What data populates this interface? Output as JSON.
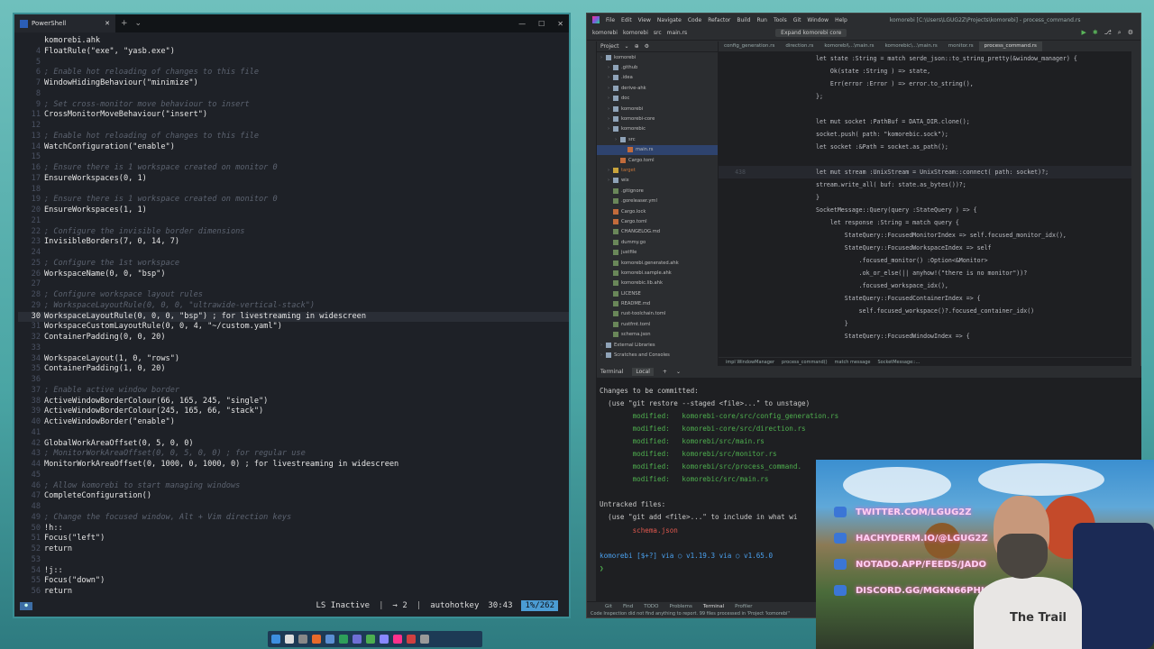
{
  "terminal": {
    "tab_title": "PowerShell",
    "filename": "komorebi.ahk",
    "lines": [
      {
        "n": "",
        "t": "komorebi.ahk",
        "c": false
      },
      {
        "n": "4",
        "t": "FloatRule(\"exe\", \"yasb.exe\")",
        "c": false
      },
      {
        "n": "5",
        "t": "",
        "c": false
      },
      {
        "n": "6",
        "t": "; Enable hot reloading of changes to this file",
        "c": true
      },
      {
        "n": "7",
        "t": "WindowHidingBehaviour(\"minimize\")",
        "c": false
      },
      {
        "n": "8",
        "t": "",
        "c": false
      },
      {
        "n": "9",
        "t": "; Set cross-monitor move behaviour to insert",
        "c": true
      },
      {
        "n": "11",
        "t": "CrossMonitorMoveBehaviour(\"insert\")",
        "c": false
      },
      {
        "n": "12",
        "t": "",
        "c": false
      },
      {
        "n": "13",
        "t": "; Enable hot reloading of changes to this file",
        "c": true
      },
      {
        "n": "14",
        "t": "WatchConfiguration(\"enable\")",
        "c": false
      },
      {
        "n": "15",
        "t": "",
        "c": false
      },
      {
        "n": "16",
        "t": "; Ensure there is 1 workspace created on monitor 0",
        "c": true
      },
      {
        "n": "17",
        "t": "EnsureWorkspaces(0, 1)",
        "c": false
      },
      {
        "n": "18",
        "t": "",
        "c": false
      },
      {
        "n": "19",
        "t": "; Ensure there is 1 workspace created on monitor 0",
        "c": true
      },
      {
        "n": "20",
        "t": "EnsureWorkspaces(1, 1)",
        "c": false
      },
      {
        "n": "21",
        "t": "",
        "c": false
      },
      {
        "n": "22",
        "t": "; Configure the invisible border dimensions",
        "c": true
      },
      {
        "n": "23",
        "t": "InvisibleBorders(7, 0, 14, 7)",
        "c": false
      },
      {
        "n": "24",
        "t": "",
        "c": false
      },
      {
        "n": "25",
        "t": "; Configure the 1st workspace",
        "c": true
      },
      {
        "n": "26",
        "t": "WorkspaceName(0, 0, \"bsp\")",
        "c": false
      },
      {
        "n": "27",
        "t": "",
        "c": false
      },
      {
        "n": "28",
        "t": "; Configure workspace layout rules",
        "c": true
      },
      {
        "n": "29",
        "t": "; WorkspaceLayoutRule(0, 0, 0, \"ultrawide-vertical-stack\")",
        "c": true
      },
      {
        "n": "30",
        "t": "WorkspaceLayoutRule(0, 0, 0, \"bsp\") ; for livestreaming in widescreen",
        "c": false,
        "cur": true
      },
      {
        "n": "31",
        "t": "WorkspaceCustomLayoutRule(0, 0, 4, \"~/custom.yaml\")",
        "c": false
      },
      {
        "n": "32",
        "t": "ContainerPadding(0, 0, 20)",
        "c": false
      },
      {
        "n": "33",
        "t": "",
        "c": false
      },
      {
        "n": "34",
        "t": "WorkspaceLayout(1, 0, \"rows\")",
        "c": false
      },
      {
        "n": "35",
        "t": "ContainerPadding(1, 0, 20)",
        "c": false
      },
      {
        "n": "36",
        "t": "",
        "c": false
      },
      {
        "n": "37",
        "t": "; Enable active window border",
        "c": true
      },
      {
        "n": "38",
        "t": "ActiveWindowBorderColour(66, 165, 245, \"single\")",
        "c": false
      },
      {
        "n": "39",
        "t": "ActiveWindowBorderColour(245, 165, 66, \"stack\")",
        "c": false
      },
      {
        "n": "40",
        "t": "ActiveWindowBorder(\"enable\")",
        "c": false
      },
      {
        "n": "41",
        "t": "",
        "c": false
      },
      {
        "n": "42",
        "t": "GlobalWorkAreaOffset(0, 5, 0, 0)",
        "c": false
      },
      {
        "n": "43",
        "t": "; MonitorWorkAreaOffset(0, 0, 5, 0, 0) ; for regular use",
        "c": true
      },
      {
        "n": "44",
        "t": "MonitorWorkAreaOffset(0, 1000, 0, 1000, 0) ; for livestreaming in widescreen",
        "c": false
      },
      {
        "n": "45",
        "t": "",
        "c": false
      },
      {
        "n": "46",
        "t": "; Allow komorebi to start managing windows",
        "c": true
      },
      {
        "n": "47",
        "t": "CompleteConfiguration()",
        "c": false
      },
      {
        "n": "48",
        "t": "",
        "c": false
      },
      {
        "n": "49",
        "t": "; Change the focused window, Alt + Vim direction keys",
        "c": true
      },
      {
        "n": "50",
        "t": "!h::",
        "c": false
      },
      {
        "n": "51",
        "t": "Focus(\"left\")",
        "c": false
      },
      {
        "n": "52",
        "t": "return",
        "c": false
      },
      {
        "n": "53",
        "t": "",
        "c": false
      },
      {
        "n": "54",
        "t": "!j::",
        "c": false
      },
      {
        "n": "55",
        "t": "Focus(\"down\")",
        "c": false
      },
      {
        "n": "56",
        "t": "return",
        "c": false
      }
    ],
    "status": {
      "lsp": "LS Inactive",
      "windows": "→ 2",
      "filetype": "autohotkey",
      "position": "30:43",
      "percent": "1%/262"
    }
  },
  "ide": {
    "menu": [
      "File",
      "Edit",
      "View",
      "Navigate",
      "Code",
      "Refactor",
      "Build",
      "Run",
      "Tools",
      "Git",
      "Window",
      "Help"
    ],
    "window_title": "komorebi [C:\\Users\\LGUG2Z\\Projects\\komorebi] - process_command.rs",
    "breadcrumb_path": [
      "komorebi",
      "komorebi",
      "src",
      "main.rs"
    ],
    "toolbar_dropdown": "Expand komorebi core",
    "project_label": "Project",
    "tree": [
      {
        "label": "komorebi",
        "depth": 0,
        "kind": "fold"
      },
      {
        "label": ".github",
        "depth": 1,
        "kind": "fold"
      },
      {
        "label": ".idea",
        "depth": 1,
        "kind": "fold"
      },
      {
        "label": "derive-ahk",
        "depth": 1,
        "kind": "fold"
      },
      {
        "label": "doc",
        "depth": 1,
        "kind": "fold"
      },
      {
        "label": "komorebi",
        "depth": 1,
        "kind": "fold"
      },
      {
        "label": "komorebi-core",
        "depth": 1,
        "kind": "fold"
      },
      {
        "label": "komorebic",
        "depth": 1,
        "kind": "fold"
      },
      {
        "label": "src",
        "depth": 2,
        "kind": "fold"
      },
      {
        "label": "main.rs",
        "depth": 3,
        "kind": "file-r",
        "sel": true
      },
      {
        "label": "Cargo.toml",
        "depth": 2,
        "kind": "file-r"
      },
      {
        "label": "target",
        "depth": 1,
        "kind": "fold-y"
      },
      {
        "label": "wix",
        "depth": 1,
        "kind": "fold"
      },
      {
        "label": ".gitignore",
        "depth": 1,
        "kind": "file-g"
      },
      {
        "label": ".goreleaser.yml",
        "depth": 1,
        "kind": "file-g"
      },
      {
        "label": "Cargo.lock",
        "depth": 1,
        "kind": "file-r"
      },
      {
        "label": "Cargo.toml",
        "depth": 1,
        "kind": "file-r"
      },
      {
        "label": "CHANGELOG.md",
        "depth": 1,
        "kind": "file-g"
      },
      {
        "label": "dummy.go",
        "depth": 1,
        "kind": "file-g"
      },
      {
        "label": "justfile",
        "depth": 1,
        "kind": "file-g"
      },
      {
        "label": "komorebi.generated.ahk",
        "depth": 1,
        "kind": "file-g"
      },
      {
        "label": "komorebi.sample.ahk",
        "depth": 1,
        "kind": "file-g"
      },
      {
        "label": "komorebic.lib.ahk",
        "depth": 1,
        "kind": "file-g"
      },
      {
        "label": "LICENSE",
        "depth": 1,
        "kind": "file-g"
      },
      {
        "label": "README.md",
        "depth": 1,
        "kind": "file-g"
      },
      {
        "label": "rust-toolchain.toml",
        "depth": 1,
        "kind": "file-g"
      },
      {
        "label": "rustfmt.toml",
        "depth": 1,
        "kind": "file-g"
      },
      {
        "label": "schema.json",
        "depth": 1,
        "kind": "file-g"
      },
      {
        "label": "External Libraries",
        "depth": 0,
        "kind": "fold"
      },
      {
        "label": "Scratches and Consoles",
        "depth": 0,
        "kind": "fold"
      }
    ],
    "code_tabs": [
      "config_generation.rs",
      "direction.rs",
      "komorebi\\...\\main.rs",
      "komorebic\\...\\main.rs",
      "monitor.rs",
      "process_command.rs"
    ],
    "code_lines": [
      {
        "n": "",
        "t": "let state :String = match serde_json::to_string_pretty(&window_manager) {"
      },
      {
        "n": "",
        "t": "    Ok(state :String ) => state,"
      },
      {
        "n": "",
        "t": "    Err(error :Error ) => error.to_string(),"
      },
      {
        "n": "",
        "t": "};"
      },
      {
        "n": "",
        "t": ""
      },
      {
        "n": "",
        "t": "let mut socket :PathBuf = DATA_DIR.clone();"
      },
      {
        "n": "",
        "t": "socket.push( path: \"komorebic.sock\");"
      },
      {
        "n": "",
        "t": "let socket :&Path = socket.as_path();"
      },
      {
        "n": "",
        "t": ""
      },
      {
        "n": "438",
        "t": "let mut stream :UnixStream = UnixStream::connect( path: socket)?;",
        "hl": true
      },
      {
        "n": "",
        "t": "stream.write_all( buf: state.as_bytes())?;"
      },
      {
        "n": "",
        "t": "}"
      },
      {
        "n": "",
        "t": "SocketMessage::Query(query :StateQuery ) => {"
      },
      {
        "n": "",
        "t": "    let response :String = match query {"
      },
      {
        "n": "",
        "t": "        StateQuery::FocusedMonitorIndex => self.focused_monitor_idx(),"
      },
      {
        "n": "",
        "t": "        StateQuery::FocusedWorkspaceIndex => self"
      },
      {
        "n": "",
        "t": "            .focused_monitor() :Option<&Monitor>"
      },
      {
        "n": "",
        "t": "            .ok_or_else(|| anyhow!(\"there is no monitor\"))?"
      },
      {
        "n": "",
        "t": "            .focused_workspace_idx(),"
      },
      {
        "n": "",
        "t": "        StateQuery::FocusedContainerIndex => {"
      },
      {
        "n": "",
        "t": "            self.focused_workspace()?.focused_container_idx()"
      },
      {
        "n": "",
        "t": "        }"
      },
      {
        "n": "",
        "t": "        StateQuery::FocusedWindowIndex => {"
      }
    ],
    "breadcrumb": [
      "impl WindowManager",
      "process_command()",
      "match message",
      "SocketMessage::..."
    ],
    "terminal_tabs": {
      "title": "Terminal",
      "local": "Local"
    },
    "terminal_lines": [
      {
        "t": "Changes to be committed:",
        "cls": ""
      },
      {
        "t": "  (use \"git restore --staged <file>...\" to unstage)",
        "cls": ""
      },
      {
        "t": "        modified:   komorebi-core/src/config_generation.rs",
        "cls": "gr"
      },
      {
        "t": "        modified:   komorebi-core/src/direction.rs",
        "cls": "gr"
      },
      {
        "t": "        modified:   komorebi/src/main.rs",
        "cls": "gr"
      },
      {
        "t": "        modified:   komorebi/src/monitor.rs",
        "cls": "gr"
      },
      {
        "t": "        modified:   komorebi/src/process_command.",
        "cls": "gr"
      },
      {
        "t": "        modified:   komorebic/src/main.rs",
        "cls": "gr"
      },
      {
        "t": "",
        "cls": ""
      },
      {
        "t": "Untracked files:",
        "cls": ""
      },
      {
        "t": "  (use \"git add <file>...\" to include in what wi",
        "cls": ""
      },
      {
        "t": "        schema.json",
        "cls": "rd"
      },
      {
        "t": "",
        "cls": ""
      },
      {
        "t": "komorebi [$+?] via ○ v1.19.3 via ○ v1.65.0",
        "cls": "prompt"
      },
      {
        "t": "❯ ",
        "cls": "gr"
      }
    ],
    "tool_windows": [
      "Git",
      "Find",
      "TODO",
      "Problems",
      "Terminal",
      "Profiler"
    ],
    "status_msg": "Code Inspection did not find anything to report. 99 files processed in 'Project 'komorebi''"
  },
  "social": [
    {
      "icon": "twitter-icon",
      "text": "TWITTER.COM/LGUG2Z"
    },
    {
      "icon": "mastodon-icon",
      "text": "HACHYDERM.IO/@LGUG2Z"
    },
    {
      "icon": "notado-icon",
      "text": "NOTADO.APP/FEEDS/JADO"
    },
    {
      "icon": "discord-icon",
      "text": "DISCORD.GG/MGKN66PHKX"
    }
  ],
  "shirt_text": "The Trail",
  "colors": {
    "accent": "#4b9cd3",
    "terminal_bg": "#1e2127",
    "ide_bg": "#2b2d30"
  }
}
